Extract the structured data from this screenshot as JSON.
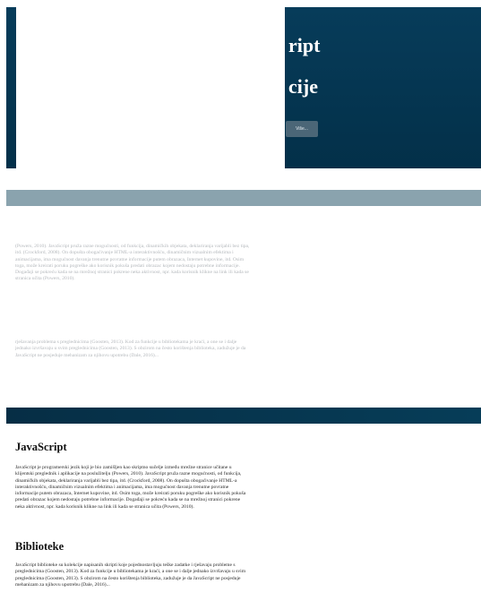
{
  "hero": {
    "title_line1": "ript",
    "title_line2": "cije",
    "button_label": "Više..."
  },
  "faded": {
    "para1": "(Powers, 2010). JavaScript pruža razne mogućnosti, od funkcija, dinamičkih objekata, deklariranja varijabli bez tipa, itd. (Crockford, 2008). On dopušta obogaćivanje HTML-a interaktivnošću, dinamičnim vizualnim efektima i animacijama, ima mogućnost davanja trenutne povratne informacije putem obrazaca, Internet kupovine, itd. Osim toga, može kreirati poruku pogreške ako korisnik pokuša predati obrazac kojem nedostaju potrebne informacije. Događaji se pokreću kada se na mrežnoj stranici pokrene neka aktivnost, npr. kada korisnik klikne na link ili kada se stranica učita (Powers, 2010).",
    "para2": "rješavanja problema s preglednicima (Goosten, 2013). Kod za funkcije u bibliotekama je kraći, a one se i dalje jednako izvršavaju u svim preglednicima (Goosten, 2013). S obzirom na često korištenja biblioteka, zadužuje je da JavaScript ne posjeduje mehanizam za njihovu upotrebu (Dale, 2016)..."
  },
  "sections": {
    "javascript": {
      "heading": "JavaScript",
      "body": "JavaScript je programerski jezik koji je bio zamišljen kao skriptno sučelje između mrežne stranice učitane u klijentski preglednik i aplikacije na poslužitelju (Powers, 2010). JavaScript pruža razne mogućnosti, od funkcija, dinamičkih objekata, deklariranja varijabli bez tipa, itd. (Crockford, 2008). On dopušta obogaćivanje HTML-a interaktivnošću, dinamičnim vizualnim efektima i animacijama, ima mogućnost davanja trenutne povratne informacije putem obrazaca, Internet kupovine, itd. Osim toga, može kreirati poruku pogreške ako korisnik pokuša predati obrazac kojem nedostaju potrebne informacije. Događaji se pokreću kada se na mrežnoj stranici pokrene neka aktivnost, npr. kada korisnik klikne na link ili kada se stranica učita (Powers, 2010)."
    },
    "biblioteke": {
      "heading": "Biblioteke",
      "body": "JavaScript biblioteke su kolekcije napisanih skripti koje pojednostavljuju teške zadatke i rješavaju probleme s preglednicima (Goosten, 2013). Kod za funkcije u bibliotekama je kraći, a one se i dalje jednako izvršavaju u svim preglednicima (Goosten, 2013). S obzirom na često korištenja biblioteka, zadužuje je da JavaScript ne posjeduje mehanizam za njihovu upotrebu (Dale, 2016)..."
    }
  },
  "colors": {
    "hero_bg": "#063a57",
    "band": "#8aa3ae",
    "button_bg": "#4b6677"
  }
}
